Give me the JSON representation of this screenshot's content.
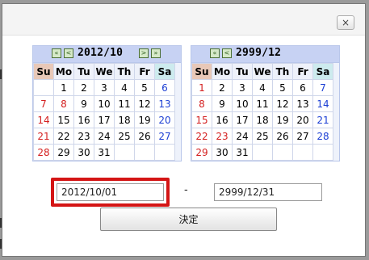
{
  "dialog": {
    "close_icon": "close-icon",
    "close_label": "×"
  },
  "calendar_from": {
    "title": "2012/10",
    "nav_prev_year": "«",
    "nav_prev_month": "<",
    "nav_next_month": ">",
    "nav_next_year": "»",
    "weekdays": [
      "Su",
      "Mo",
      "Tu",
      "We",
      "Th",
      "Fr",
      "Sa"
    ],
    "weeks": [
      [
        "",
        "1",
        "2",
        "3",
        "4",
        "5",
        "6"
      ],
      [
        "7",
        "8",
        "9",
        "10",
        "11",
        "12",
        "13"
      ],
      [
        "14",
        "15",
        "16",
        "17",
        "18",
        "19",
        "20"
      ],
      [
        "21",
        "22",
        "23",
        "24",
        "25",
        "26",
        "27"
      ],
      [
        "28",
        "29",
        "30",
        "31",
        "",
        "",
        ""
      ]
    ]
  },
  "calendar_to": {
    "title": "2999/12",
    "nav_prev_year": "«",
    "nav_prev_month": "<",
    "weekdays": [
      "Su",
      "Mo",
      "Tu",
      "We",
      "Th",
      "Fr",
      "Sa"
    ],
    "weeks": [
      [
        "1",
        "2",
        "3",
        "4",
        "5",
        "6",
        "7"
      ],
      [
        "8",
        "9",
        "10",
        "11",
        "12",
        "13",
        "14"
      ],
      [
        "15",
        "16",
        "17",
        "18",
        "19",
        "20",
        "21"
      ],
      [
        "22",
        "23",
        "24",
        "25",
        "26",
        "27",
        "28"
      ],
      [
        "29",
        "30",
        "31",
        "",
        "",
        "",
        ""
      ]
    ]
  },
  "range": {
    "from_value": "2012/10/01",
    "separator": "-",
    "to_value": "2999/12/31"
  },
  "submit_label": "決定",
  "colors": {
    "sunday": "#d42020",
    "saturday": "#1c3fd4",
    "highlight_border": "#d41515"
  }
}
